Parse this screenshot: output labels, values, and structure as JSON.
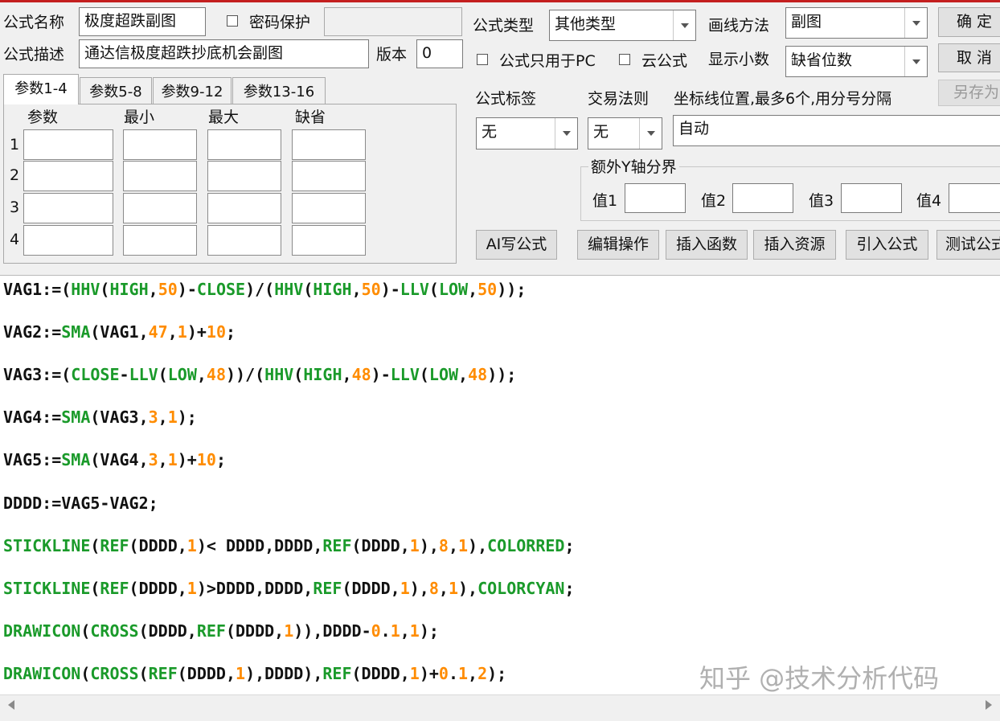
{
  "labels": {
    "formula_name": "公式名称",
    "password_protect": "密码保护",
    "formula_desc": "公式描述",
    "version": "版本",
    "formula_type": "公式类型",
    "draw_method": "画线方法",
    "pc_only": "公式只用于PC",
    "cloud_formula": "云公式",
    "display_decimals": "显示小数",
    "formula_tag": "公式标签",
    "trade_rule": "交易法则",
    "axis_positions": "坐标线位置,最多6个,用分号分隔",
    "extra_y_axis": "额外Y轴分界",
    "val1": "值1",
    "val2": "值2",
    "val3": "值3",
    "val4": "值4"
  },
  "fields": {
    "formula_name": "极度超跌副图",
    "password": "",
    "formula_desc": "通达信极度超跌抄底机会副图",
    "version": "0",
    "axis_positions": "自动",
    "val1": "",
    "val2": "",
    "val3": "",
    "val4": ""
  },
  "checkboxes": {
    "password_protect": false,
    "pc_only": false,
    "cloud_formula": false
  },
  "selects": {
    "formula_type": "其他类型",
    "draw_method": "副图",
    "display_decimals": "缺省位数",
    "formula_tag": "无",
    "trade_rule": "无"
  },
  "buttons": {
    "ok": "确 定",
    "cancel": "取 消",
    "save_as": "另存为",
    "ai_write": "AI写公式",
    "edit_ops": "编辑操作",
    "insert_func": "插入函数",
    "insert_res": "插入资源",
    "import_formula": "引入公式",
    "test_formula": "测试公式"
  },
  "param_tabs": [
    "参数1-4",
    "参数5-8",
    "参数9-12",
    "参数13-16"
  ],
  "param_headers": [
    "参数",
    "最小",
    "最大",
    "缺省"
  ],
  "param_rows": [
    "1",
    "2",
    "3",
    "4"
  ],
  "code_lines": [
    [
      [
        "n",
        "VAG1:=("
      ],
      [
        "f",
        "HHV"
      ],
      [
        "n",
        "("
      ],
      [
        "f",
        "HIGH"
      ],
      [
        "n",
        ","
      ],
      [
        "o",
        "50"
      ],
      [
        "n",
        ")-"
      ],
      [
        "f",
        "CLOSE"
      ],
      [
        "n",
        ")/("
      ],
      [
        "f",
        "HHV"
      ],
      [
        "n",
        "("
      ],
      [
        "f",
        "HIGH"
      ],
      [
        "n",
        ","
      ],
      [
        "o",
        "50"
      ],
      [
        "n",
        ")-"
      ],
      [
        "f",
        "LLV"
      ],
      [
        "n",
        "("
      ],
      [
        "f",
        "LOW"
      ],
      [
        "n",
        ","
      ],
      [
        "o",
        "50"
      ],
      [
        "n",
        "));"
      ]
    ],
    [
      [
        "n",
        "VAG2:="
      ],
      [
        "f",
        "SMA"
      ],
      [
        "n",
        "(VAG1,"
      ],
      [
        "o",
        "47"
      ],
      [
        "n",
        ","
      ],
      [
        "o",
        "1"
      ],
      [
        "n",
        ")+"
      ],
      [
        "o",
        "10"
      ],
      [
        "n",
        ";"
      ]
    ],
    [
      [
        "n",
        "VAG3:=("
      ],
      [
        "f",
        "CLOSE"
      ],
      [
        "n",
        "-"
      ],
      [
        "f",
        "LLV"
      ],
      [
        "n",
        "("
      ],
      [
        "f",
        "LOW"
      ],
      [
        "n",
        ","
      ],
      [
        "o",
        "48"
      ],
      [
        "n",
        "))/("
      ],
      [
        "f",
        "HHV"
      ],
      [
        "n",
        "("
      ],
      [
        "f",
        "HIGH"
      ],
      [
        "n",
        ","
      ],
      [
        "o",
        "48"
      ],
      [
        "n",
        ")-"
      ],
      [
        "f",
        "LLV"
      ],
      [
        "n",
        "("
      ],
      [
        "f",
        "LOW"
      ],
      [
        "n",
        ","
      ],
      [
        "o",
        "48"
      ],
      [
        "n",
        "));"
      ]
    ],
    [
      [
        "n",
        "VAG4:="
      ],
      [
        "f",
        "SMA"
      ],
      [
        "n",
        "(VAG3,"
      ],
      [
        "o",
        "3"
      ],
      [
        "n",
        ","
      ],
      [
        "o",
        "1"
      ],
      [
        "n",
        ");"
      ]
    ],
    [
      [
        "n",
        "VAG5:="
      ],
      [
        "f",
        "SMA"
      ],
      [
        "n",
        "(VAG4,"
      ],
      [
        "o",
        "3"
      ],
      [
        "n",
        ","
      ],
      [
        "o",
        "1"
      ],
      [
        "n",
        ")+"
      ],
      [
        "o",
        "10"
      ],
      [
        "n",
        ";"
      ]
    ],
    [
      [
        "n",
        "DDDD:=VAG5-VAG2;"
      ]
    ],
    [
      [
        "f",
        "STICKLINE"
      ],
      [
        "n",
        "("
      ],
      [
        "f",
        "REF"
      ],
      [
        "n",
        "(DDDD,"
      ],
      [
        "o",
        "1"
      ],
      [
        "n",
        ")< DDDD,DDDD,"
      ],
      [
        "f",
        "REF"
      ],
      [
        "n",
        "(DDDD,"
      ],
      [
        "o",
        "1"
      ],
      [
        "n",
        "),"
      ],
      [
        "o",
        "8"
      ],
      [
        "n",
        ","
      ],
      [
        "o",
        "1"
      ],
      [
        "n",
        "),"
      ],
      [
        "f",
        "COLORRED"
      ],
      [
        "n",
        ";"
      ]
    ],
    [
      [
        "f",
        "STICKLINE"
      ],
      [
        "n",
        "("
      ],
      [
        "f",
        "REF"
      ],
      [
        "n",
        "(DDDD,"
      ],
      [
        "o",
        "1"
      ],
      [
        "n",
        ")>DDDD,DDDD,"
      ],
      [
        "f",
        "REF"
      ],
      [
        "n",
        "(DDDD,"
      ],
      [
        "o",
        "1"
      ],
      [
        "n",
        "),"
      ],
      [
        "o",
        "8"
      ],
      [
        "n",
        ","
      ],
      [
        "o",
        "1"
      ],
      [
        "n",
        "),"
      ],
      [
        "f",
        "COLORCYAN"
      ],
      [
        "n",
        ";"
      ]
    ],
    [
      [
        "f",
        "DRAWICON"
      ],
      [
        "n",
        "("
      ],
      [
        "f",
        "CROSS"
      ],
      [
        "n",
        "(DDDD,"
      ],
      [
        "f",
        "REF"
      ],
      [
        "n",
        "(DDDD,"
      ],
      [
        "o",
        "1"
      ],
      [
        "n",
        "))"
      ],
      [
        "n",
        ",DDDD-"
      ],
      [
        "o",
        "0"
      ],
      [
        "n",
        "."
      ],
      [
        "o",
        "1"
      ],
      [
        "n",
        ","
      ],
      [
        "o",
        "1"
      ],
      [
        "n",
        ");"
      ]
    ],
    [
      [
        "f",
        "DRAWICON"
      ],
      [
        "n",
        "("
      ],
      [
        "f",
        "CROSS"
      ],
      [
        "n",
        "("
      ],
      [
        "f",
        "REF"
      ],
      [
        "n",
        "(DDDD,"
      ],
      [
        "o",
        "1"
      ],
      [
        "n",
        "),DDDD),"
      ],
      [
        "f",
        "REF"
      ],
      [
        "n",
        "(DDDD,"
      ],
      [
        "o",
        "1"
      ],
      [
        "n",
        ")+"
      ],
      [
        "o",
        "0"
      ],
      [
        "n",
        "."
      ],
      [
        "o",
        "1"
      ],
      [
        "n",
        ","
      ],
      [
        "o",
        "2"
      ],
      [
        "n",
        ");"
      ]
    ]
  ],
  "watermark": "知乎 @技术分析代码"
}
